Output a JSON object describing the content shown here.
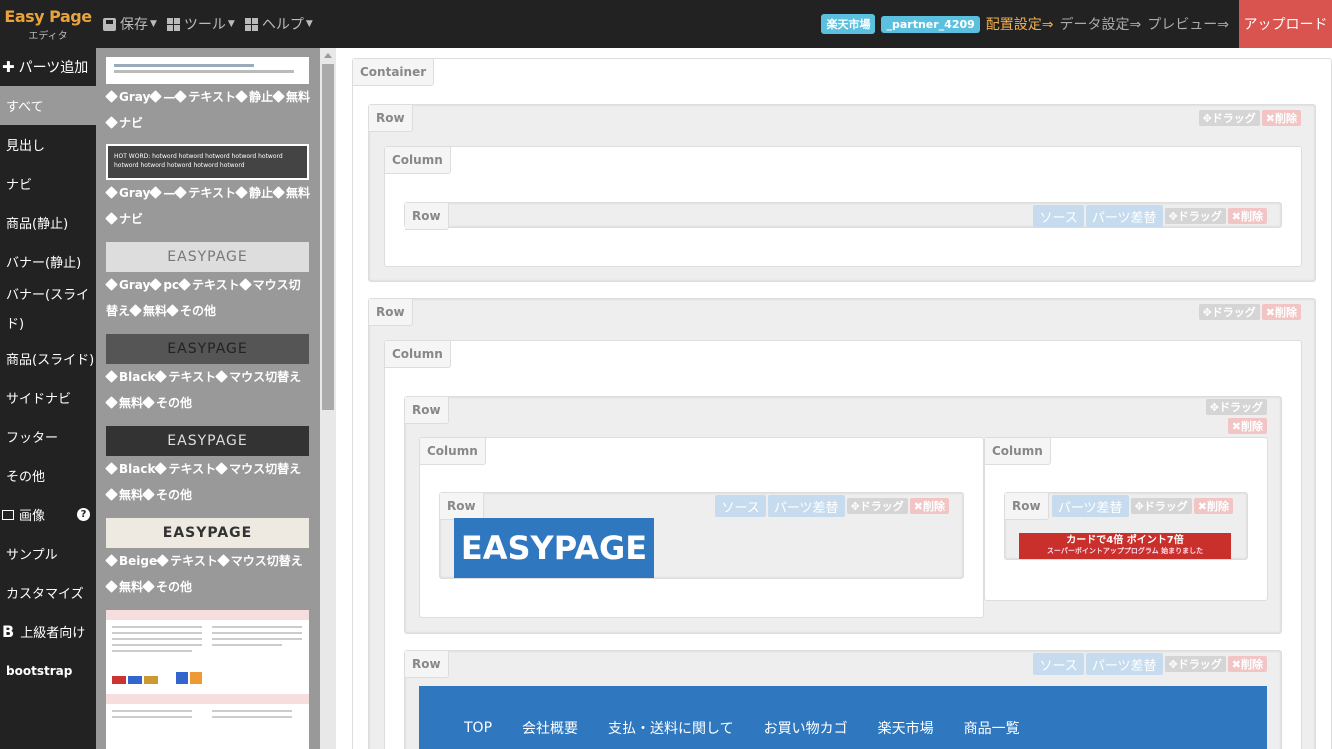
{
  "app": {
    "title": "Easy Page",
    "subtitle": "エディタ"
  },
  "menu": {
    "save": "保存",
    "tools": "ツール",
    "help": "ヘルプ"
  },
  "topright": {
    "badge_market": "楽天市場",
    "badge_partner": "_partner_4209",
    "step_layout": "配置設定⇒",
    "step_data": "データ設定⇒",
    "step_preview": "プレビュー⇒",
    "upload": "アップロード"
  },
  "sidebar": {
    "add_parts": "パーツ追加",
    "items": [
      "すべて",
      "見出し",
      "ナビ",
      "商品(静止)",
      "バナー(静止)",
      "バナー(スライド)",
      "商品(スライド)",
      "サイドナビ",
      "フッター",
      "その他"
    ],
    "image_head": "画像",
    "image_items": [
      "サンプル",
      "カスタマイズ"
    ],
    "advanced": "上級者向け",
    "bootstrap": "bootstrap"
  },
  "parts": [
    {
      "tags": [
        "Gray",
        "—",
        "テキスト",
        "静止",
        "無料",
        "ナビ"
      ]
    },
    {
      "thumb_text": "HOT WORD:  hotword  hotword  hotword  hotword  hotword  hotword  hotword  hotword  hotword  hotword",
      "tags": [
        "Gray",
        "—",
        "テキスト",
        "静止",
        "無料",
        "ナビ"
      ]
    },
    {
      "thumb_text": "EASYPAGE",
      "tags": [
        "Gray",
        "pc",
        "テキスト",
        "マウス切替え",
        "無料",
        "その他"
      ]
    },
    {
      "thumb_text": "EASYPAGE",
      "tags": [
        "Black",
        "テキスト",
        "マウス切替え",
        "無料",
        "その他"
      ]
    },
    {
      "thumb_text": "EASYPAGE",
      "tags": [
        "Black",
        "テキスト",
        "マウス切替え",
        "無料",
        "その他"
      ]
    },
    {
      "thumb_text": "EASYPAGE",
      "tags": [
        "Beige",
        "テキスト",
        "マウス切替え",
        "無料",
        "その他"
      ]
    }
  ],
  "canvas": {
    "container": "Container",
    "row": "Row",
    "column": "Column",
    "drag": "✥ドラッグ",
    "delete": "✖削除",
    "source": "ソース",
    "swap": "パーツ差替",
    "logo_text": "EASYPAGE",
    "banner_text": "カードで4倍 ポイント7倍",
    "banner_sub": "スーパーポイントアッププログラム 始まりました",
    "nav": [
      "TOP",
      "会社概要",
      "支払・送料に関して",
      "お買い物カゴ",
      "楽天市場",
      "商品一覧"
    ]
  }
}
